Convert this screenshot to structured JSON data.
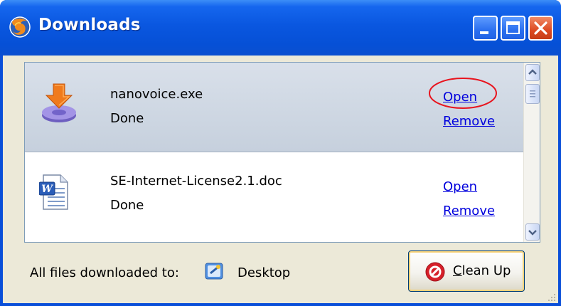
{
  "window": {
    "title": "Downloads",
    "icon": "firefox-icon",
    "controls": [
      "minimize-icon",
      "maximize-icon",
      "close-icon"
    ]
  },
  "downloads": [
    {
      "filename": "nanovoice.exe",
      "status": "Done",
      "icon": "installer-download-icon",
      "open_label": "Open",
      "remove_label": "Remove",
      "selected": true
    },
    {
      "filename": "SE-Internet-License2.1.doc",
      "status": "Done",
      "icon": "word-document-icon",
      "open_label": "Open",
      "remove_label": "Remove",
      "selected": false
    }
  ],
  "footer": {
    "prefix": "All files downloaded to:",
    "folder_icon": "desktop-folder-icon",
    "folder_name": "Desktop",
    "cleanup_label_first": "C",
    "cleanup_label_rest": "lean Up",
    "cleanup_icon": "cancel-icon"
  },
  "annotation": {
    "shape": "red-ellipse",
    "color": "#e8141e",
    "target": "Open"
  },
  "colors": {
    "title_bar": "#0a57e0",
    "close_button": "#dd4a22",
    "link": "#0000dd",
    "selected_row": "#c6d0dd",
    "dialog_bg": "#ece9d8"
  }
}
